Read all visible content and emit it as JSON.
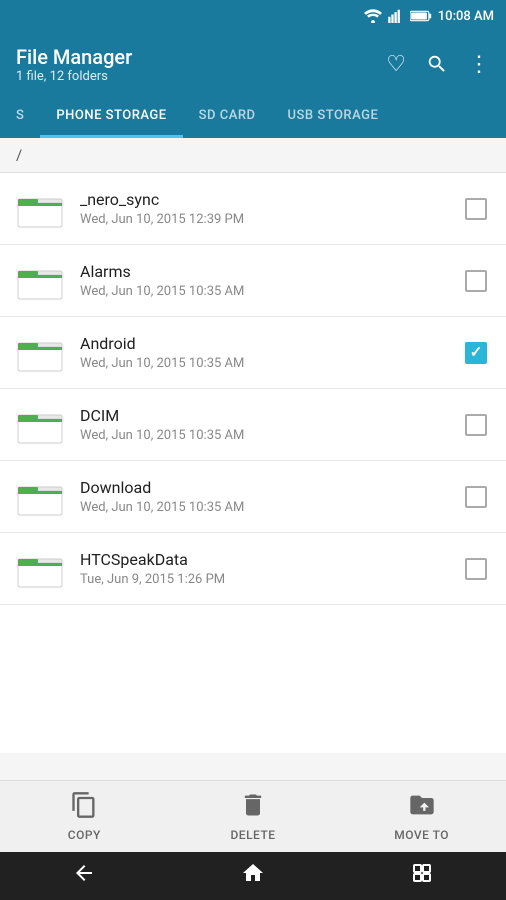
{
  "statusBar": {
    "time": "10:08 AM"
  },
  "appBar": {
    "title": "File Manager",
    "subtitle": "1 file, 12 folders",
    "favoriteIcon": "♥",
    "searchIcon": "search",
    "moreIcon": "⋮"
  },
  "tabs": [
    {
      "label": "S",
      "active": false
    },
    {
      "label": "PHONE STORAGE",
      "active": true
    },
    {
      "label": "SD CARD",
      "active": false
    },
    {
      "label": "USB STORAGE",
      "active": false
    }
  ],
  "breadcrumb": "/",
  "files": [
    {
      "name": "_nero_sync",
      "date": "Wed, Jun 10, 2015 12:39 PM",
      "checked": false
    },
    {
      "name": "Alarms",
      "date": "Wed, Jun 10, 2015 10:35 AM",
      "checked": false
    },
    {
      "name": "Android",
      "date": "Wed, Jun 10, 2015 10:35 AM",
      "checked": true
    },
    {
      "name": "DCIM",
      "date": "Wed, Jun 10, 2015 10:35 AM",
      "checked": false
    },
    {
      "name": "Download",
      "date": "Wed, Jun 10, 2015 10:35 AM",
      "checked": false
    },
    {
      "name": "HTCSpeakData",
      "date": "Tue, Jun 9, 2015 1:26 PM",
      "checked": false
    }
  ],
  "toolbar": {
    "copy": "COPY",
    "delete": "DELETE",
    "moveto": "MOVE TO"
  }
}
